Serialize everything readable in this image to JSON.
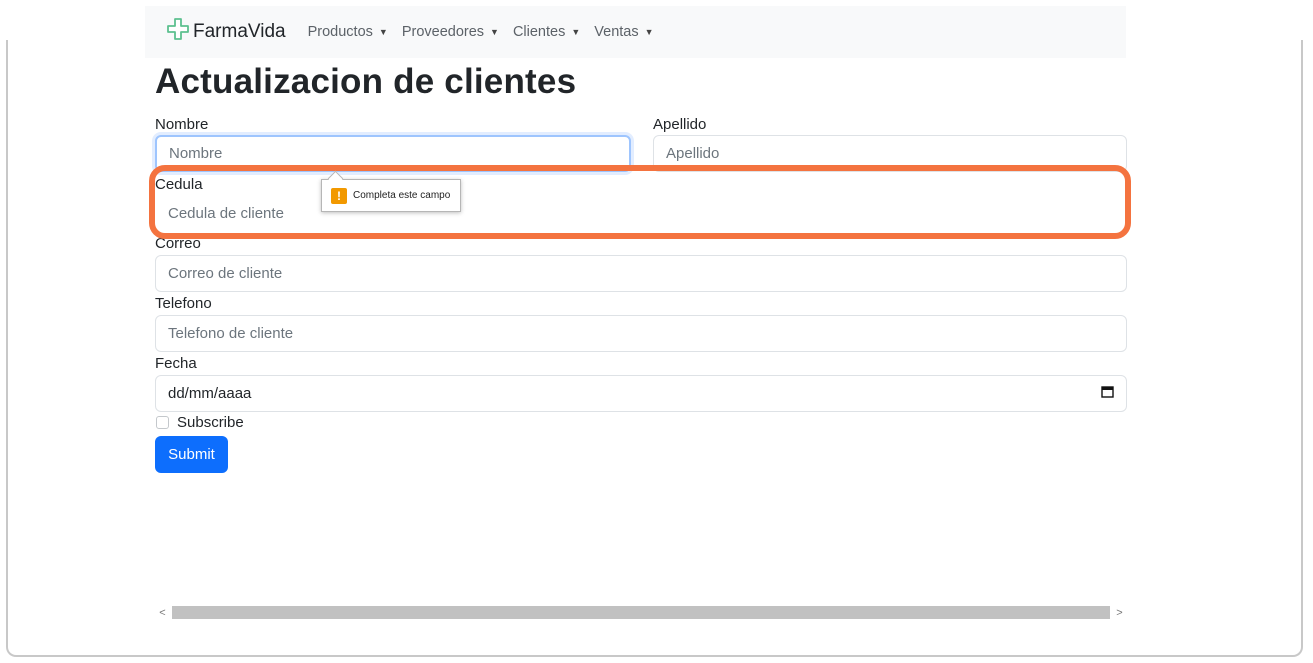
{
  "navbar": {
    "brand": "FarmaVida",
    "items": [
      {
        "label": "Productos"
      },
      {
        "label": "Proveedores"
      },
      {
        "label": "Clientes"
      },
      {
        "label": "Ventas"
      }
    ]
  },
  "page": {
    "title": "Actualizacion de clientes"
  },
  "form": {
    "nombre": {
      "label": "Nombre",
      "placeholder": "Nombre",
      "value": ""
    },
    "apellido": {
      "label": "Apellido",
      "placeholder": "Apellido",
      "value": ""
    },
    "cedula": {
      "label": "Cedula",
      "placeholder": "Cedula de cliente",
      "value": ""
    },
    "correo": {
      "label": "Correo",
      "placeholder": "Correo de cliente",
      "value": ""
    },
    "telefono": {
      "label": "Telefono",
      "placeholder": "Telefono de cliente",
      "value": ""
    },
    "fecha": {
      "label": "Fecha",
      "value": "dd/mm/aaaa"
    },
    "subscribe": {
      "label": "Subscribe",
      "checked": false
    },
    "submit_label": "Submit"
  },
  "tooltip": {
    "message": "Completa este campo"
  },
  "colors": {
    "primary": "#0d6efd",
    "highlight": "#f4733f",
    "warning": "#f29900",
    "brand_icon": "#5cc08f"
  },
  "icons": {
    "brand": "medical-cross-icon",
    "calendar": "calendar-icon",
    "warning": "warning-icon"
  }
}
